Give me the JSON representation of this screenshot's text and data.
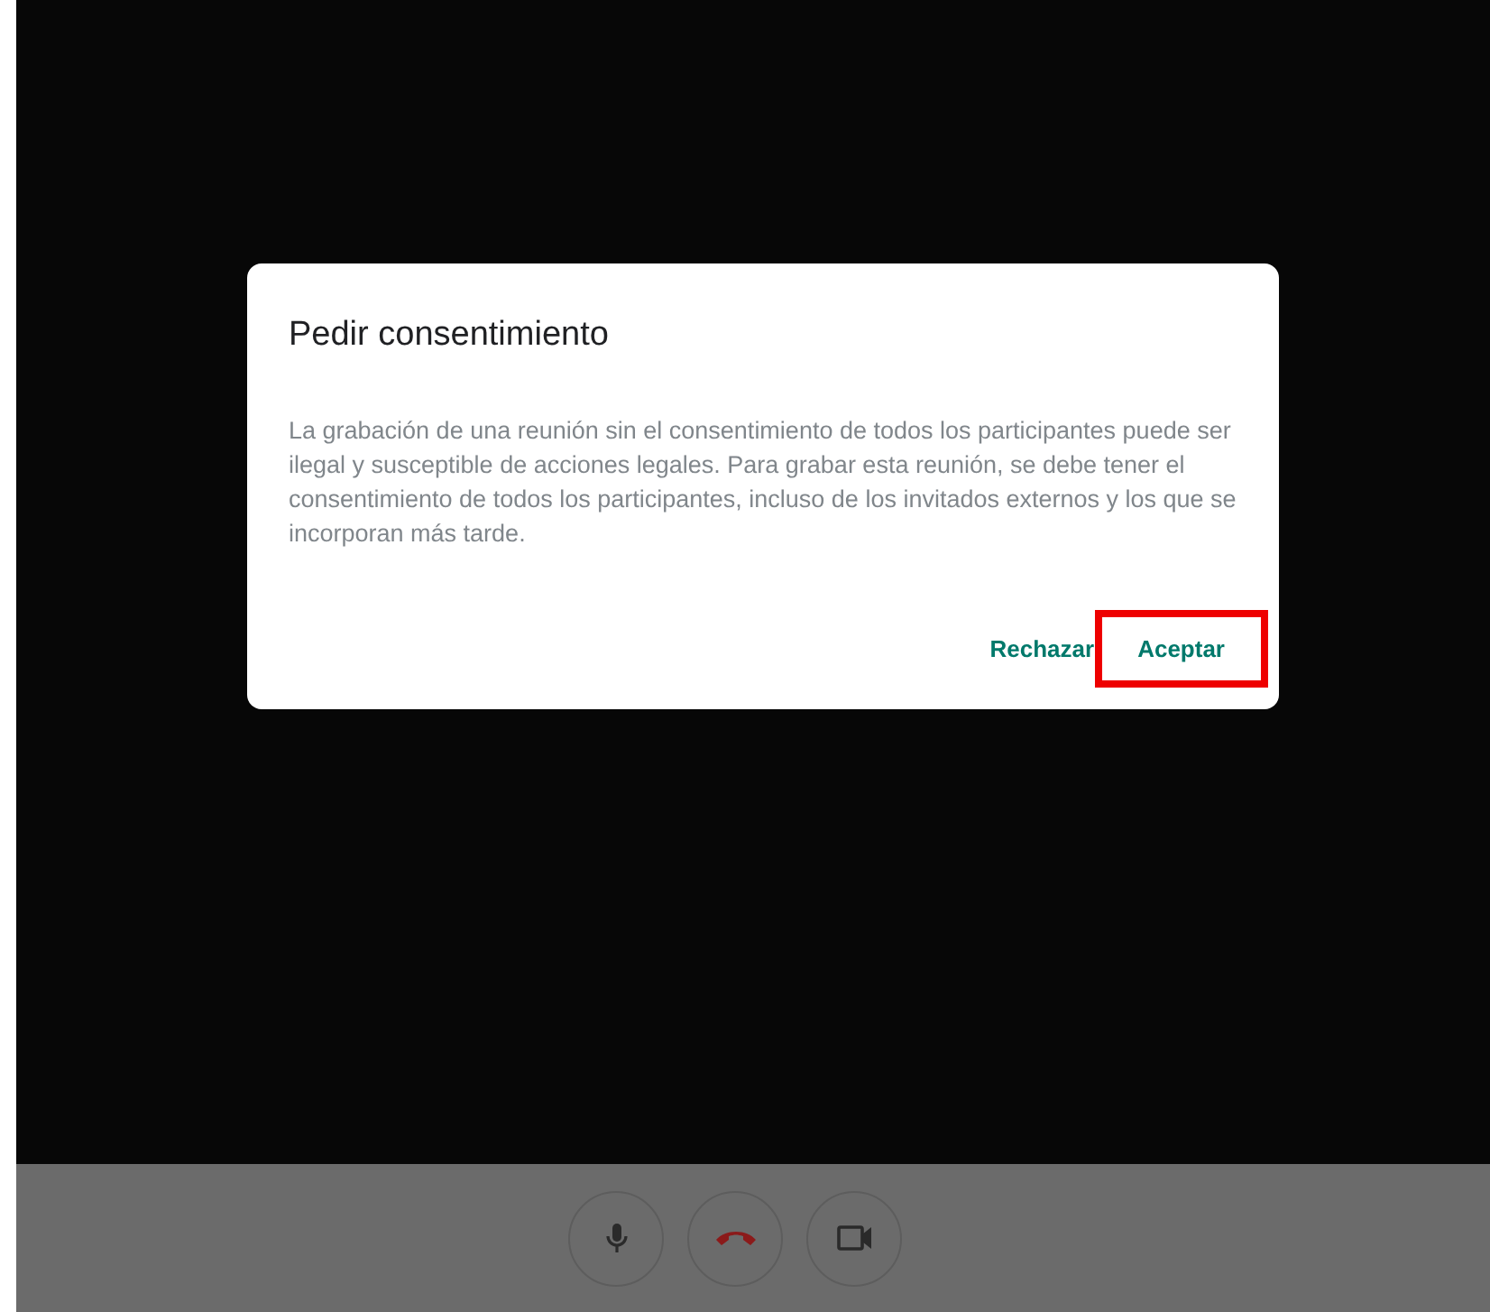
{
  "dialog": {
    "title": "Pedir consentimiento",
    "message": "La grabación de una reunión sin el consentimiento de todos los participantes puede ser ilegal y susceptible de acciones legales. Para grabar esta reunión, se debe tener el consentimiento de todos los participantes, incluso de los invitados externos y los que se incorporan más tarde.",
    "buttons": [
      {
        "label": "Rechazar",
        "highlighted": false
      },
      {
        "label": "Aceptar",
        "highlighted": true
      }
    ]
  },
  "controls": [
    {
      "kind": "microphone"
    },
    {
      "kind": "hangup"
    },
    {
      "kind": "camera"
    }
  ]
}
